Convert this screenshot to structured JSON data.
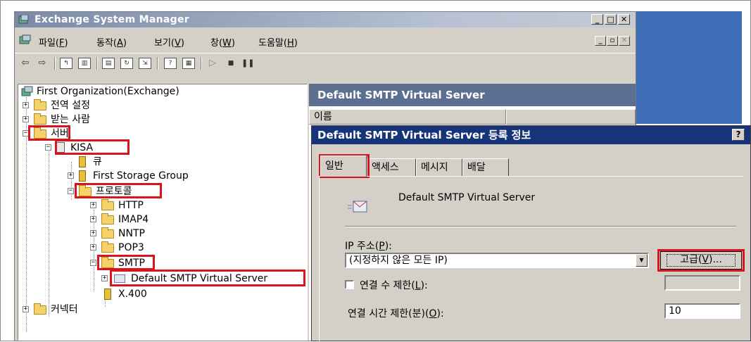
{
  "window": {
    "title": "Exchange System Manager"
  },
  "menu": {
    "items": [
      {
        "label": "파일(",
        "key": "F",
        "tail": ")"
      },
      {
        "label": "동작(",
        "key": "A",
        "tail": ")"
      },
      {
        "label": "보기(",
        "key": "V",
        "tail": ")"
      },
      {
        "label": "창(",
        "key": "W",
        "tail": ")"
      },
      {
        "label": "도움말(",
        "key": "H",
        "tail": ")"
      }
    ]
  },
  "toolbar": {
    "icons": [
      "back-arrow-icon",
      "forward-arrow-icon",
      "up-folder-icon",
      "show-tree-icon",
      "properties-icon",
      "refresh-icon",
      "export-list-icon",
      "help-icon",
      "console-icon",
      "start-icon",
      "stop-icon",
      "pause-icon"
    ]
  },
  "tree": {
    "root": "First Organization(Exchange)",
    "global_settings": "전역 설정",
    "recipients": "받는 사람",
    "servers": "서버",
    "server_kisa": "KISA",
    "queues": "큐",
    "storage_group": "First Storage Group",
    "protocols": "프로토콜",
    "http": "HTTP",
    "imap4": "IMAP4",
    "nntp": "NNTP",
    "pop3": "POP3",
    "smtp": "SMTP",
    "smtp_vs": "Default SMTP Virtual Server",
    "x400": "X.400",
    "connectors": "커넥터"
  },
  "right_pane": {
    "header": "Default SMTP Virtual Server",
    "columns": [
      "이름",
      ""
    ]
  },
  "dialog": {
    "title": "Default SMTP Virtual Server 등록 정보",
    "help": "?",
    "tabs": [
      "일반",
      "액세스",
      "메시지",
      "배달"
    ],
    "server_name": "Default SMTP Virtual Server",
    "ip_label_pre": "IP 주소(",
    "ip_label_key": "P",
    "ip_label_post": "):",
    "ip_value": "(지정하지 않은 모든 IP)",
    "advanced_pre": "고급(",
    "advanced_key": "V",
    "advanced_post": ")...",
    "limit_pre": "연결 수 제한(",
    "limit_key": "L",
    "limit_post": "):",
    "timeout_pre": "연결 시간 제한(분)(",
    "timeout_key": "O",
    "timeout_post": "):",
    "timeout_value": "10"
  },
  "colors": {
    "highlight": "#d8141c",
    "dialog_title": "#17337a",
    "pane_header": "#5d6f91"
  }
}
